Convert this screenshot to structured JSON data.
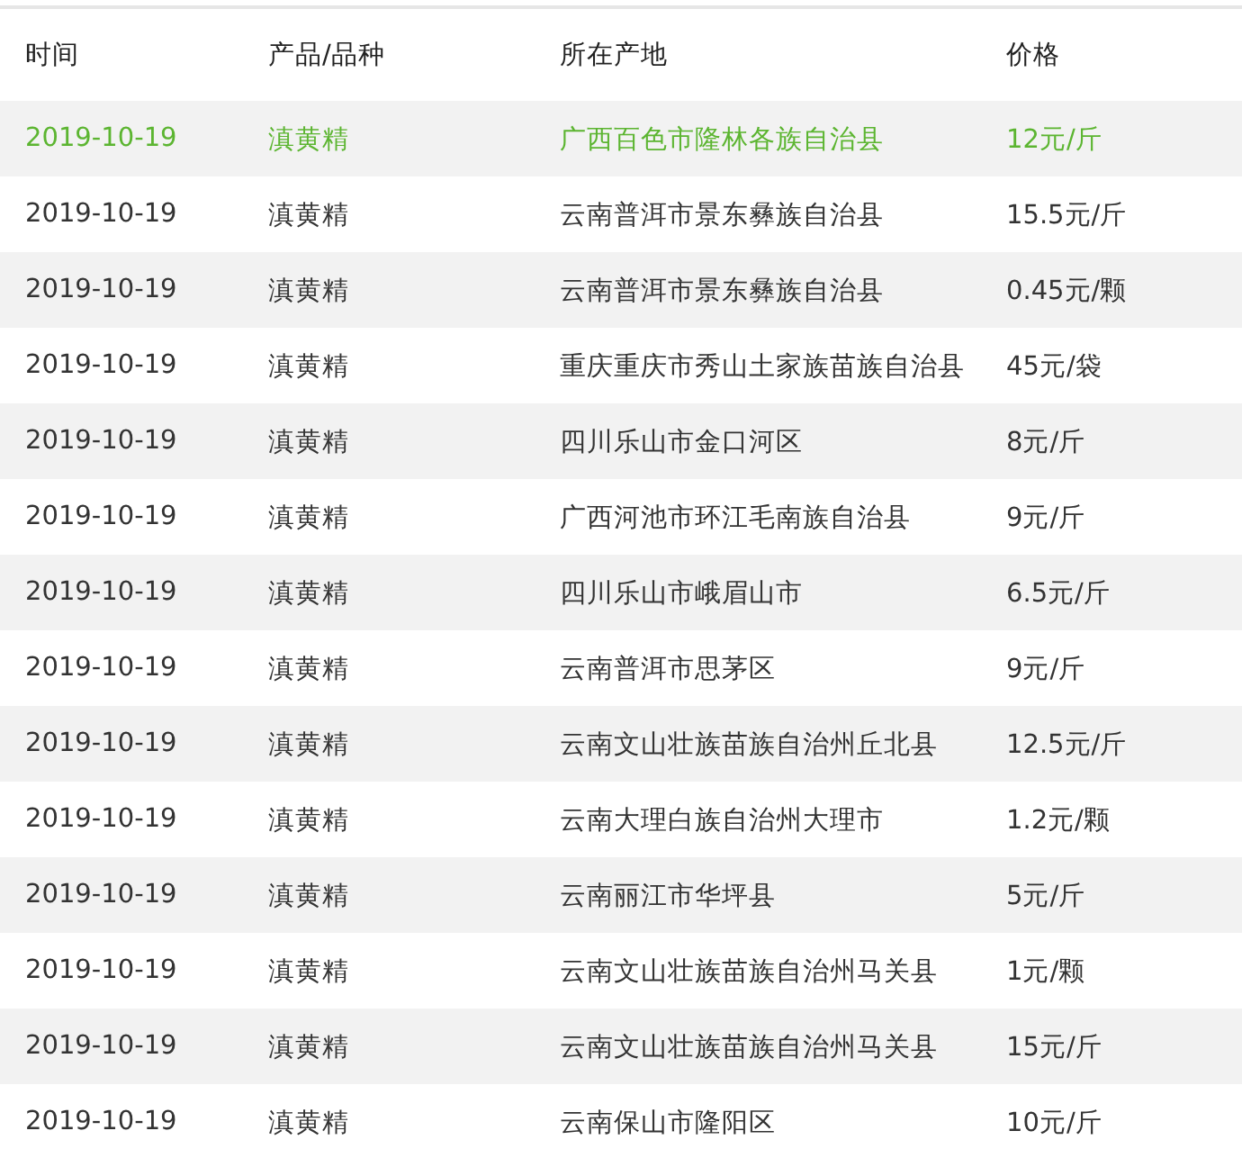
{
  "table": {
    "columns": [
      "时间",
      "产品/品种",
      "所在产地",
      "价格"
    ],
    "rows": [
      {
        "cells": [
          "2019-10-19",
          "滇黄精",
          "广西百色市隆林各族自治县",
          "12元/斤"
        ],
        "highlighted": true
      },
      {
        "cells": [
          "2019-10-19",
          "滇黄精",
          "云南普洱市景东彝族自治县",
          "15.5元/斤"
        ],
        "highlighted": false
      },
      {
        "cells": [
          "2019-10-19",
          "滇黄精",
          "云南普洱市景东彝族自治县",
          "0.45元/颗"
        ],
        "highlighted": false
      },
      {
        "cells": [
          "2019-10-19",
          "滇黄精",
          "重庆重庆市秀山土家族苗族自治县",
          "45元/袋"
        ],
        "highlighted": false
      },
      {
        "cells": [
          "2019-10-19",
          "滇黄精",
          "四川乐山市金口河区",
          "8元/斤"
        ],
        "highlighted": false
      },
      {
        "cells": [
          "2019-10-19",
          "滇黄精",
          "广西河池市环江毛南族自治县",
          "9元/斤"
        ],
        "highlighted": false
      },
      {
        "cells": [
          "2019-10-19",
          "滇黄精",
          "四川乐山市峨眉山市",
          "6.5元/斤"
        ],
        "highlighted": false
      },
      {
        "cells": [
          "2019-10-19",
          "滇黄精",
          "云南普洱市思茅区",
          "9元/斤"
        ],
        "highlighted": false
      },
      {
        "cells": [
          "2019-10-19",
          "滇黄精",
          "云南文山壮族苗族自治州丘北县",
          "12.5元/斤"
        ],
        "highlighted": false
      },
      {
        "cells": [
          "2019-10-19",
          "滇黄精",
          "云南大理白族自治州大理市",
          "1.2元/颗"
        ],
        "highlighted": false
      },
      {
        "cells": [
          "2019-10-19",
          "滇黄精",
          "云南丽江市华坪县",
          "5元/斤"
        ],
        "highlighted": false
      },
      {
        "cells": [
          "2019-10-19",
          "滇黄精",
          "云南文山壮族苗族自治州马关县",
          "1元/颗"
        ],
        "highlighted": false
      },
      {
        "cells": [
          "2019-10-19",
          "滇黄精",
          "云南文山壮族苗族自治州马关县",
          "15元/斤"
        ],
        "highlighted": false
      },
      {
        "cells": [
          "2019-10-19",
          "滇黄精",
          "云南保山市隆阳区",
          "10元/斤"
        ],
        "highlighted": false
      }
    ]
  }
}
